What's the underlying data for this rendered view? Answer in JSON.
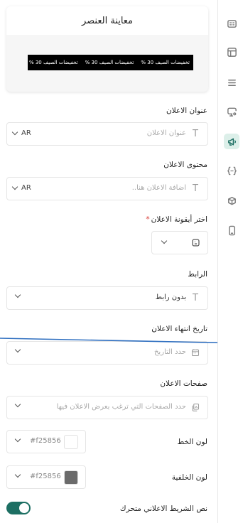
{
  "preview": {
    "title": "معاينة العنصر",
    "marquee_items": [
      "تخفيضات الصيف 30 %",
      "تخفيضات الصيف 30 %",
      "تخفيضات الصيف 30 %"
    ],
    "marquee_bg": "#000000",
    "marquee_color": "#ffffff"
  },
  "ad_title": {
    "label": "عنوان الاعلان",
    "placeholder": "عنوان الاعلان",
    "lang": "AR"
  },
  "ad_content": {
    "label": "محتوى الاعلان",
    "placeholder": "اضافة الاعلان هنا..",
    "lang": "AR"
  },
  "ad_icon": {
    "label": "اختر أيقونة الاعلان",
    "required_mark": "*"
  },
  "link": {
    "label": "الرابط",
    "value": "بدون رابط"
  },
  "expiry": {
    "label": "تاريخ انتهاء الاعلان",
    "placeholder": "حدد التاريخ"
  },
  "pages": {
    "label": "صفحات الاعلان",
    "placeholder": "حدد الصفحات التي ترغب بعرض الاعلان فيها"
  },
  "font_color": {
    "label": "لون الخط",
    "hex": "#f25856",
    "swatch": "#ffffff"
  },
  "bg_color": {
    "label": "لون الخلفية",
    "hex": "#f25856",
    "swatch": "#6b6b6b"
  },
  "animated": {
    "label": "نص الشريط الاعلاني متحرك",
    "on": true
  },
  "accent": "#1d6f63",
  "rail_icons": [
    "card-icon",
    "layout-icon",
    "list-icon",
    "settings-screen-icon",
    "megaphone-icon",
    "code-braces-icon",
    "box-icon",
    "phone-icon"
  ]
}
